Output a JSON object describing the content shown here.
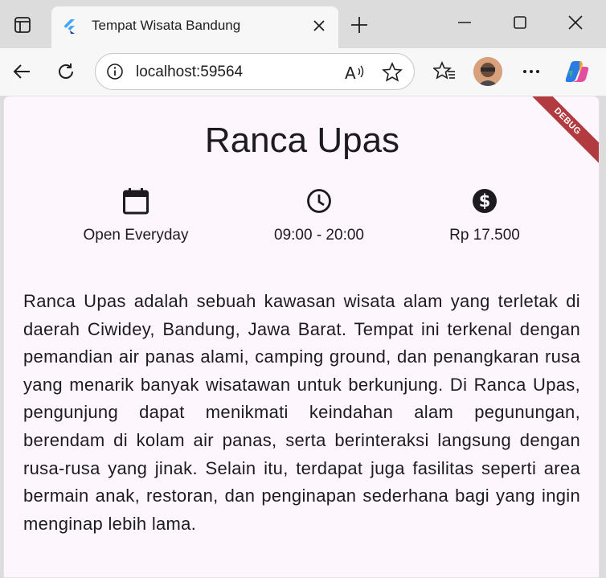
{
  "browser": {
    "tab_title": "Tempat Wisata Bandung",
    "url": "localhost:59564"
  },
  "badge": {
    "debug": "DEBUG"
  },
  "place": {
    "name": "Ranca Upas",
    "info": [
      {
        "icon": "calendar-icon",
        "label": "Open Everyday"
      },
      {
        "icon": "clock-icon",
        "label": "09:00 - 20:00"
      },
      {
        "icon": "dollar-icon",
        "label": "Rp 17.500"
      }
    ],
    "description": "Ranca Upas adalah sebuah kawasan wisata alam yang terletak di daerah Ciwidey, Bandung, Jawa Barat. Tempat ini terkenal dengan pemandian air panas alami, camping ground, dan penangkaran rusa yang menarik banyak wisatawan untuk berkunjung. Di Ranca Upas, pengunjung dapat menikmati keindahan alam pegunungan, berendam di kolam air panas, serta berinteraksi langsung dengan rusa-rusa yang jinak. Selain itu, terdapat juga fasilitas seperti area bermain anak, restoran, dan penginapan sederhana bagi yang ingin menginap lebih lama."
  },
  "colors": {
    "debug_banner": "#b23b3f",
    "page_bg": "#fdf7fd"
  }
}
